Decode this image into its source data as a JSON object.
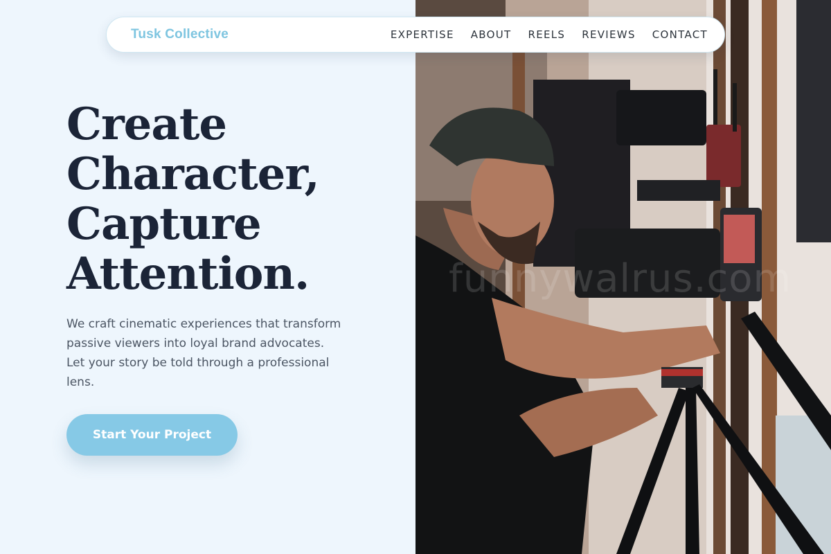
{
  "nav": {
    "brand": "Tusk Collective",
    "items": [
      {
        "label": "EXPERTISE"
      },
      {
        "label": "ABOUT"
      },
      {
        "label": "REELS"
      },
      {
        "label": "REVIEWS"
      },
      {
        "label": "CONTACT"
      }
    ]
  },
  "hero": {
    "title_lines": [
      "Create",
      "Character,",
      "Capture",
      "Attention."
    ],
    "description": "We craft cinematic experiences that transform passive viewers into loyal brand advocates. Let your story be told through a professional lens.",
    "cta_label": "Start Your Project"
  },
  "photo": {
    "watermark": "funnywalrus.com"
  },
  "colors": {
    "page_background": "#eef6fd",
    "brand": "#7ec5e0",
    "heading": "#1b2437",
    "body_text": "#4b5563",
    "cta_background": "#86c9e6"
  }
}
